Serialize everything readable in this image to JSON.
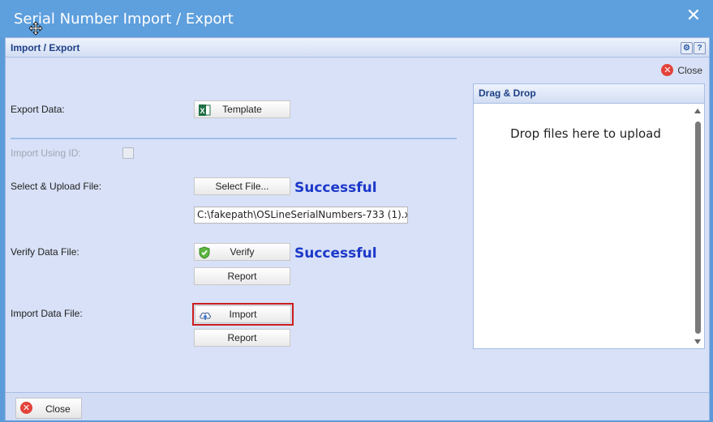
{
  "window": {
    "title": "Serial Number Import / Export"
  },
  "panel": {
    "title": "Import / Export",
    "close_label": "Close"
  },
  "export": {
    "label": "Export Data:",
    "template_button": "Template"
  },
  "import_using_id": {
    "label": "Import Using ID:",
    "checked": false
  },
  "upload": {
    "label": "Select & Upload File:",
    "select_button": "Select File...",
    "status": "Successful",
    "file_path": "C:\\fakepath\\OSLineSerialNumbers-733 (1).x"
  },
  "verify": {
    "label": "Verify Data File:",
    "verify_button": "Verify",
    "status": "Successful",
    "report_button": "Report"
  },
  "import_data": {
    "label": "Import Data File:",
    "import_button": "Import",
    "report_button": "Report"
  },
  "dragdrop": {
    "title": "Drag & Drop",
    "message": "Drop files here to upload"
  },
  "footer": {
    "close_label": "Close"
  },
  "colors": {
    "accent": "#5e9fdd",
    "status": "#1c38c9",
    "highlight": "#cc1d1d"
  }
}
